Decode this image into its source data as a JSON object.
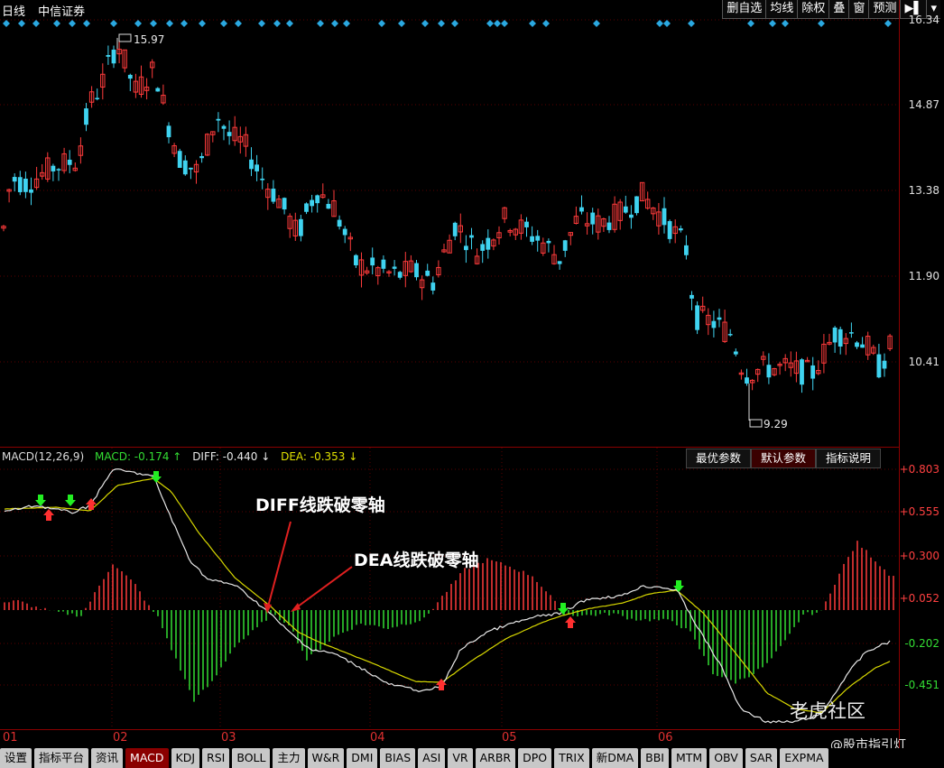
{
  "header": {
    "period": "日线",
    "stock_name": "中信证券",
    "buttons": [
      "删自选",
      "均线",
      "除权",
      "叠",
      "窗",
      "预测",
      "▶▌",
      "▾"
    ]
  },
  "price_axis": {
    "ticks": [
      "16.34",
      "14.87",
      "13.38",
      "11.90",
      "10.41"
    ]
  },
  "price_extremes": {
    "high": "15.97",
    "low": "9.29"
  },
  "macd_header": {
    "name": "MACD(12,26,9)",
    "macd": "MACD: -0.174 ↑",
    "diff": "DIFF: -0.440 ↓",
    "dea": "DEA: -0.353 ↓"
  },
  "macd_buttons": [
    "最优参数",
    "默认参数",
    "指标说明"
  ],
  "macd_axis": {
    "ticks": [
      "+0.803",
      "+0.555",
      "+0.300",
      "+0.052",
      "-0.202",
      "-0.451"
    ]
  },
  "annotations": {
    "diff_cross": "DIFF线跌破零轴",
    "dea_cross": "DEA线跌破零轴"
  },
  "x_axis": {
    "labels": [
      "01",
      "02",
      "03",
      "04",
      "05",
      "06"
    ]
  },
  "tabs": [
    "设置",
    "指标平台",
    "资讯",
    "MACD",
    "KDJ",
    "RSI",
    "BOLL",
    "主力",
    "W&R",
    "DMI",
    "BIAS",
    "ASI",
    "VR",
    "ARBR",
    "DPO",
    "TRIX",
    "新DMA",
    "BBI",
    "MTM",
    "OBV",
    "SAR",
    "EXPMA"
  ],
  "active_tab": "MACD",
  "watermark": {
    "brand": "老虎社区",
    "author": "@股市指引灯"
  },
  "colors": {
    "up": "#ff3b3b",
    "down": "#3fd3f0",
    "diff": "#e8e8e8",
    "dea": "#d8d800",
    "bar_pos": "#ff3b3b",
    "bar_neg": "#33dd33"
  }
}
